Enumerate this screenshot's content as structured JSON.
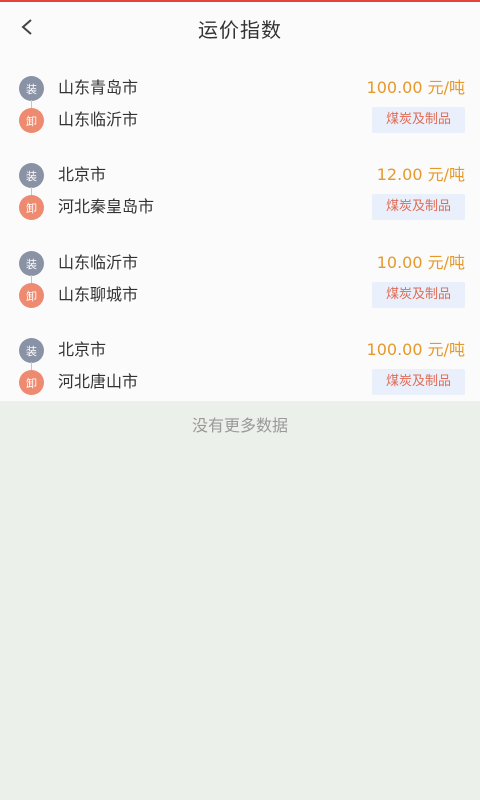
{
  "header": {
    "title": "运价指数",
    "back_icon": "chevron-left-icon"
  },
  "badges": {
    "load": "装",
    "unload": "卸"
  },
  "items": [
    {
      "from": "山东青岛市",
      "to": "山东临沂市",
      "price": "100.00 元/吨",
      "cargo": "煤炭及制品"
    },
    {
      "from": "北京市",
      "to": "河北秦皇岛市",
      "price": "12.00 元/吨",
      "cargo": "煤炭及制品"
    },
    {
      "from": "山东临沂市",
      "to": "山东聊城市",
      "price": "10.00 元/吨",
      "cargo": "煤炭及制品"
    },
    {
      "from": "北京市",
      "to": "河北唐山市",
      "price": "100.00 元/吨",
      "cargo": "煤炭及制品"
    }
  ],
  "footer": {
    "no_more_text": "没有更多数据"
  },
  "colors": {
    "accent_line": "#e0443c",
    "price": "#e5992a",
    "load_badge": "#8a93a5",
    "unload_badge": "#ee8a6f",
    "tag_bg": "#eaf0fb",
    "tag_text": "#e06b55"
  }
}
